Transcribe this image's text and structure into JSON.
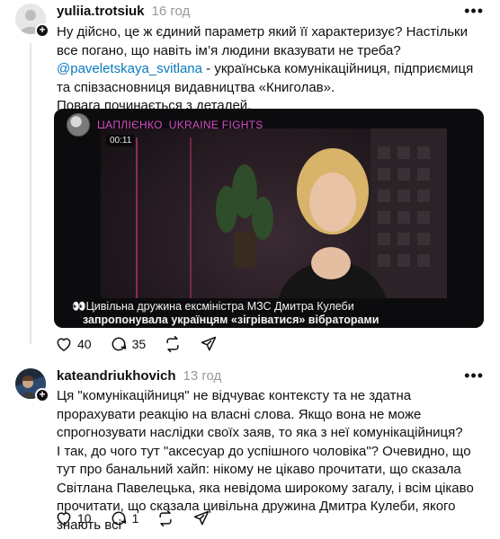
{
  "posts": [
    {
      "username": "yuliia.trotsiuk",
      "time": "16 год",
      "more_label": "•••",
      "paragraphs": [
        "Ну дійсно, це ж єдиний параметр який її характеризує? Настільки все погано, що навіть ім’я людини вказувати не треба?",
        "- українська комунікаційниця, підприємиця та співзасновниця видавництва «Книголав».",
        "Повага починається з деталей."
      ],
      "mention": "@paveletskaya_svitlana",
      "media": {
        "channel_name": "ЦАПЛІЄНКО_UKRAINE FIGHTS",
        "duration": "00:11",
        "caption_line1": "👀Цивільна дружина ексміністра МЗС Дмитра Кулеби",
        "caption_line2": "запропонувала українцям «зігріватися» вібраторами"
      },
      "actions": {
        "likes": "40",
        "replies": "35"
      }
    },
    {
      "username": "kateandriukhovich",
      "time": "13 год",
      "more_label": "•••",
      "paragraphs": [
        "Ця \"комунікаційниця\" не відчуває контексту та не здатна прорахувати реакцію на власні слова. Якщо вона не може спрогнозувати наслідки своїх заяв, то яка з неї комунікаційниця?",
        "І так, до чого тут \"аксесуар до успішного чоловіка\"? Очевидно, що тут про банальний хайп: нікому не цікаво прочитати, що сказала Світлана Павелецька, яка невідома широкому загалу, і всім цікаво прочитати, що сказала цивільна дружина Дмитра Кулеби, якого знають всі"
      ],
      "actions": {
        "likes": "10",
        "replies": "1"
      }
    }
  ],
  "icons": {
    "like": "heart-icon",
    "reply": "comment-icon",
    "repost": "repost-icon",
    "share": "send-icon",
    "follow": "plus-icon"
  },
  "colors": {
    "mention": "#0a7bbf",
    "channel": "#d84cc5",
    "muted": "#999999"
  }
}
